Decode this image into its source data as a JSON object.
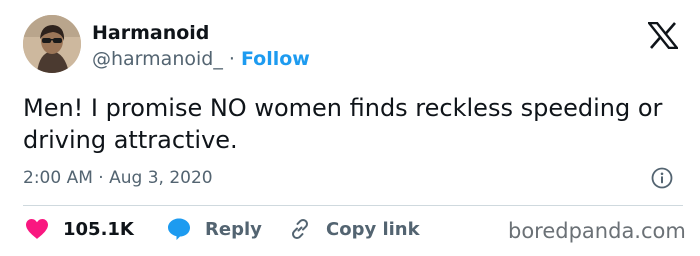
{
  "author": {
    "display_name": "Harmanoid",
    "handle": "@harmanoid_",
    "separator": "·",
    "follow_label": "Follow"
  },
  "tweet": {
    "text": "Men! I promise NO women finds reckless speeding or driving attractive."
  },
  "timestamp": {
    "time": "2:00 AM",
    "separator": "·",
    "date": "Aug 3, 2020"
  },
  "actions": {
    "likes_count": "105.1K",
    "reply_label": "Reply",
    "copy_link_label": "Copy link"
  },
  "watermark": "boredpanda.com",
  "colors": {
    "accent": "#1d9bf0",
    "like": "#f91880",
    "text": "#0f1419",
    "secondary": "#536471",
    "divider": "#cfd9de"
  },
  "icons": [
    "x-logo-icon",
    "info-icon",
    "heart-icon",
    "reply-bubble-icon",
    "link-icon"
  ]
}
